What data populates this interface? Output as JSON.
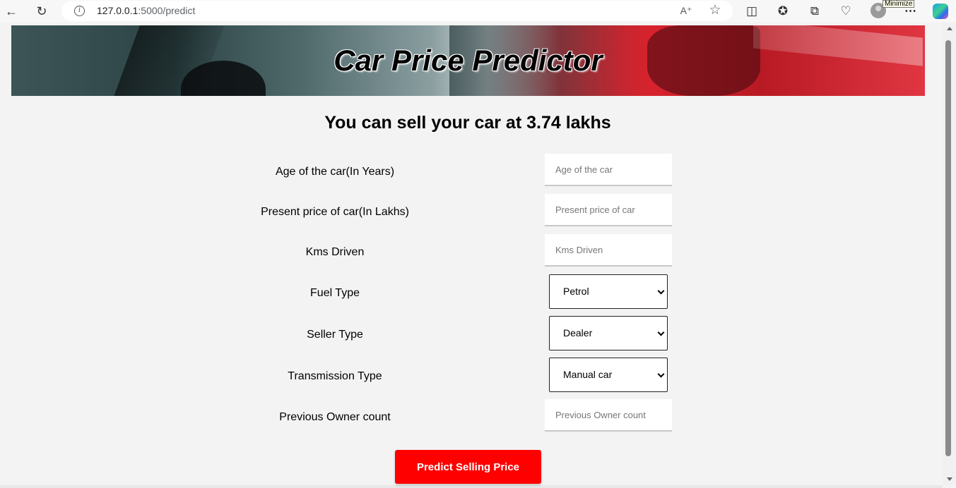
{
  "browser": {
    "url_host": "127.0.0.1",
    "url_path": ":5000/predict",
    "tooltip": "Minimize"
  },
  "banner": {
    "title": "Car Price Predictor"
  },
  "result": {
    "text": "You can sell your car at 3.74 lakhs"
  },
  "form": {
    "age_label": "Age of the car(In Years)",
    "age_placeholder": "Age of the car",
    "price_label": "Present price of car(In Lakhs)",
    "price_placeholder": "Present price of car",
    "kms_label": "Kms Driven",
    "kms_placeholder": "Kms Driven",
    "fuel_label": "Fuel Type",
    "fuel_value": "Petrol",
    "seller_label": "Seller Type",
    "seller_value": "Dealer",
    "transmission_label": "Transmission Type",
    "transmission_value": "Manual car",
    "owner_label": "Previous Owner count",
    "owner_placeholder": "Previous Owner count",
    "submit_label": "Predict Selling Price"
  },
  "icons": {
    "back": "back-arrow-icon",
    "reload": "reload-icon",
    "info": "info-icon",
    "read_aloud": "read-aloud-icon",
    "favorite": "star-icon",
    "split": "split-screen-icon",
    "favorites": "favorites-icon",
    "collections": "collections-icon",
    "health": "browser-essentials-icon",
    "profile": "profile-avatar-icon",
    "more": "more-icon",
    "copilot": "copilot-icon"
  },
  "colors": {
    "accent": "#ff0000",
    "page_bg": "#f3f3f3"
  }
}
